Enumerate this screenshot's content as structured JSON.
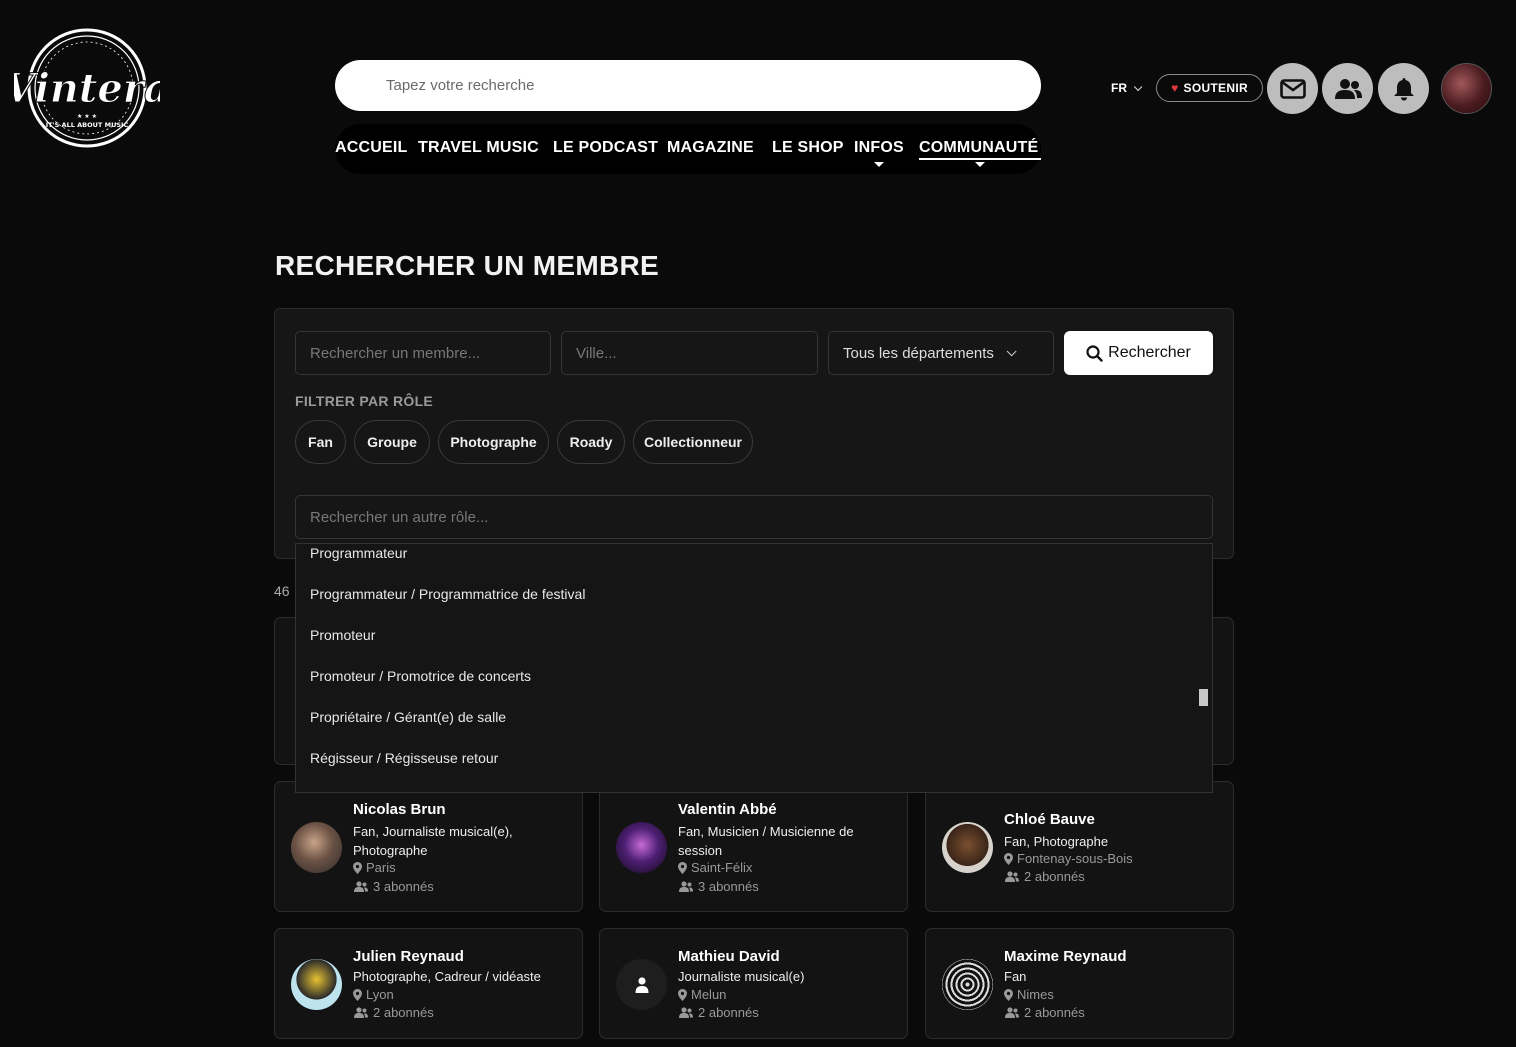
{
  "brand": {
    "logo_text": "Vintera",
    "tagline": "IT'S ALL ABOUT MUSIC"
  },
  "header": {
    "search_placeholder": "Tapez votre recherche",
    "nav": [
      "ACCUEIL",
      "TRAVEL MUSIC",
      "LE PODCAST",
      "MAGAZINE",
      "LE SHOP",
      "INFOS",
      "COMMUNAUTÉ"
    ],
    "lang": "FR",
    "support_label": "SOUTENIR"
  },
  "page": {
    "title": "RECHERCHER UN MEMBRE",
    "member_placeholder": "Rechercher un membre...",
    "city_placeholder": "Ville...",
    "department_selected": "Tous les départements",
    "search_button": "Rechercher",
    "filter_label": "FILTRER PAR RÔLE",
    "role_chips": [
      "Fan",
      "Groupe",
      "Photographe",
      "Roady",
      "Collectionneur"
    ],
    "other_role_placeholder": "Rechercher un autre rôle...",
    "results_count": "46"
  },
  "dropdown": {
    "items": [
      "Programmateur",
      "Programmateur / Programmatrice de festival",
      "Promoteur",
      "Promoteur / Promotrice de concerts",
      "Propriétaire / Gérant(e) de salle",
      "Régisseur / Régisseuse retour"
    ]
  },
  "members": [
    {
      "name": "Nicolas Brun",
      "roles": "Fan, Journaliste musical(e), Photographe",
      "city": "Paris",
      "subs": "3 abonnés"
    },
    {
      "name": "Valentin Abbé",
      "roles": "Fan, Musicien / Musicienne de session",
      "city": "Saint-Félix",
      "subs": "3 abonnés"
    },
    {
      "name": "Chloé Bauve",
      "roles": "Fan, Photographe",
      "city": "Fontenay-sous-Bois",
      "subs": "2 abonnés"
    },
    {
      "name": "Julien Reynaud",
      "roles": "Photographe, Cadreur / vidéaste",
      "city": "Lyon",
      "subs": "2 abonnés"
    },
    {
      "name": "Mathieu David",
      "roles": "Journaliste musical(e)",
      "city": "Melun",
      "subs": "2 abonnés"
    },
    {
      "name": "Maxime Reynaud",
      "roles": "Fan",
      "city": "Nimes",
      "subs": "2 abonnés"
    }
  ],
  "colors": {
    "background": "#0b0a0b",
    "panel": "#161616",
    "heart": "#e23a3a"
  }
}
